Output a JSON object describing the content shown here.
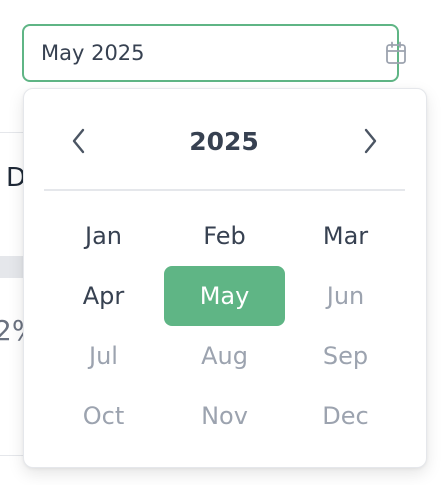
{
  "background": {
    "partial_heading": "D",
    "partial_percent": "2%"
  },
  "input": {
    "value": "May 2025",
    "icon": "calendar-icon",
    "border_color": "#5fb585"
  },
  "picker": {
    "year": "2025",
    "prev_icon": "chevron-left-icon",
    "next_icon": "chevron-right-icon",
    "selected": "May",
    "accent_color": "#5fb585",
    "months": [
      {
        "label": "Jan",
        "state": "enabled"
      },
      {
        "label": "Feb",
        "state": "enabled"
      },
      {
        "label": "Mar",
        "state": "enabled"
      },
      {
        "label": "Apr",
        "state": "enabled"
      },
      {
        "label": "May",
        "state": "selected"
      },
      {
        "label": "Jun",
        "state": "disabled"
      },
      {
        "label": "Jul",
        "state": "disabled"
      },
      {
        "label": "Aug",
        "state": "disabled"
      },
      {
        "label": "Sep",
        "state": "disabled"
      },
      {
        "label": "Oct",
        "state": "disabled"
      },
      {
        "label": "Nov",
        "state": "disabled"
      },
      {
        "label": "Dec",
        "state": "disabled"
      }
    ]
  }
}
